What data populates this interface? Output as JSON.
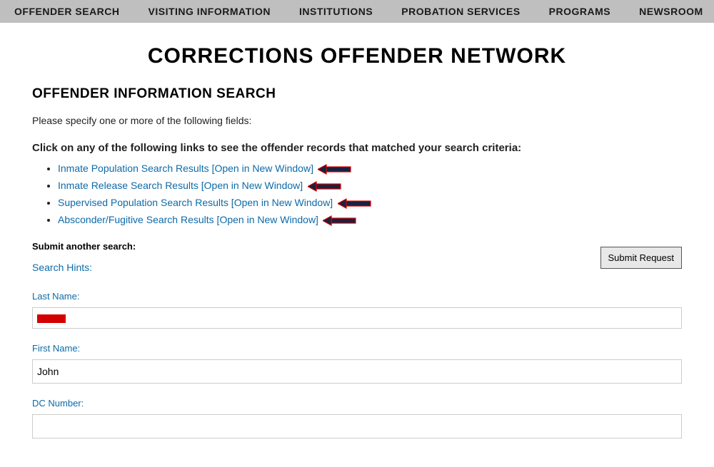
{
  "nav": {
    "items": [
      "OFFENDER SEARCH",
      "VISITING INFORMATION",
      "INSTITUTIONS",
      "PROBATION SERVICES",
      "PROGRAMS",
      "NEWSROOM"
    ]
  },
  "page_title": "CORRECTIONS OFFENDER NETWORK",
  "section_title": "OFFENDER INFORMATION SEARCH",
  "instruction": "Please specify one or more of the following fields:",
  "bold_instruction": "Click on any of the following links to see the offender records that matched your search criteria:",
  "results": [
    "Inmate Population Search Results [Open in New Window]",
    "Inmate Release Search Results [Open in New Window]",
    "Supervised Population Search Results [Open in New Window]",
    "Absconder/Fugitive Search Results [Open in New Window]"
  ],
  "submit_another": "Submit another search:",
  "submit_button": "Submit Request",
  "search_hints": "Search Hints:",
  "form": {
    "last_name_label": "Last Name:",
    "last_name_value": "",
    "first_name_label": "First Name:",
    "first_name_value": "John",
    "dc_number_label": "DC Number:",
    "dc_number_value": ""
  }
}
